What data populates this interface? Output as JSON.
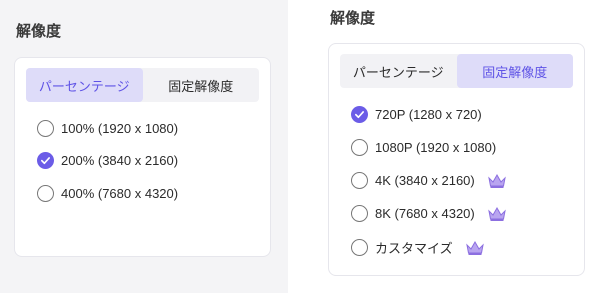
{
  "left_panel": {
    "title": "解像度",
    "tabs": [
      {
        "label": "パーセンテージ",
        "active": true
      },
      {
        "label": "固定解像度",
        "active": false
      }
    ],
    "options": [
      {
        "label": "100% (1920 x 1080)",
        "selected": false
      },
      {
        "label": "200% (3840 x 2160)",
        "selected": true
      },
      {
        "label": "400% (7680 x 4320)",
        "selected": false
      }
    ]
  },
  "right_panel": {
    "title": "解像度",
    "tabs": [
      {
        "label": "パーセンテージ",
        "active": false
      },
      {
        "label": "固定解像度",
        "active": true
      }
    ],
    "options": [
      {
        "label": "720P (1280 x 720)",
        "selected": true,
        "premium": false
      },
      {
        "label": "1080P (1920 x 1080)",
        "selected": false,
        "premium": false
      },
      {
        "label": "4K (3840 x 2160)",
        "selected": false,
        "premium": true
      },
      {
        "label": "8K (7680 x 4320)",
        "selected": false,
        "premium": true
      },
      {
        "label": "カスタマイズ",
        "selected": false,
        "premium": true
      }
    ]
  },
  "colors": {
    "accent": "#6b5ce7",
    "tab_active_bg": "#dedcf9",
    "crown": "#9b7de0"
  },
  "icons": {
    "checked": "check-icon",
    "premium": "crown-icon"
  }
}
